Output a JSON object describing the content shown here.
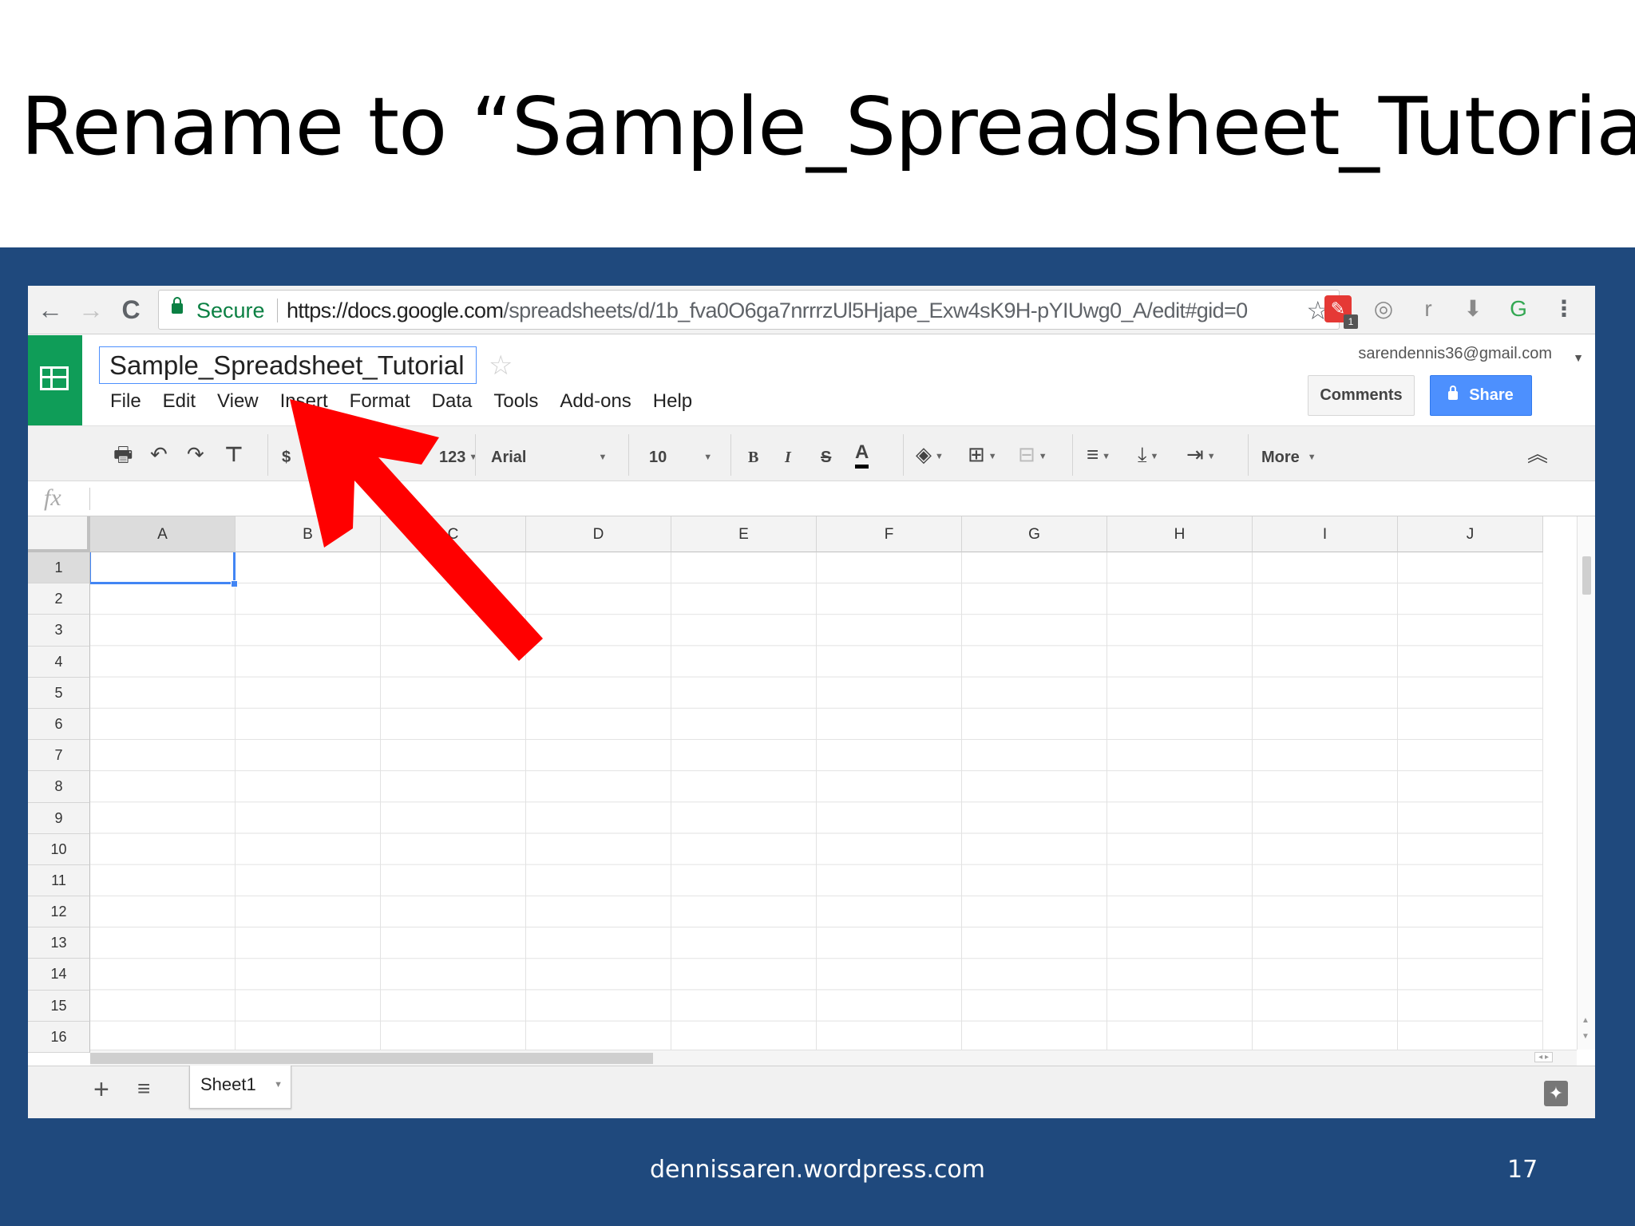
{
  "slide": {
    "title": "Rename to “Sample_Spreadsheet_Tutorial”",
    "footer_site": "dennissaren.wordpress.com",
    "page_number": "17"
  },
  "browser": {
    "back_icon": "←",
    "forward_icon": "→",
    "reload_icon": "C",
    "secure_label": "Secure",
    "url_host": "https://docs.google.com",
    "url_path": "/spreadsheets/d/1b_fva0O6ga7nrrrzUl5Hjape_Exw4sK9H-pYIUwg0_A/edit#gid=0",
    "bookmark_icon": "☆",
    "extensions": [
      "ext-red-icon",
      "ext-gray-icon",
      "ext-r-icon",
      "ext-download-icon",
      "ext-grammarly-icon",
      "menu-dots-icon"
    ],
    "ext_badge": "1",
    "ext_r_label": "r",
    "menu_icon": "⋮"
  },
  "sheets": {
    "doc_title": "Sample_Spreadsheet_Tutorial",
    "title_star": "☆",
    "menu": [
      "File",
      "Edit",
      "View",
      "Insert",
      "Format",
      "Data",
      "Tools",
      "Add-ons",
      "Help"
    ],
    "account": "sarendennis36@gmail.com",
    "comments_label": "Comments",
    "share_label": "Share"
  },
  "toolbar": {
    "currency": "$",
    "more_formats": "123",
    "font": "Arial",
    "font_size": "10",
    "bold": "B",
    "italic": "I",
    "strike": "S",
    "text_color": "A",
    "more_label": "More",
    "collapse_icon": "︽"
  },
  "formula": {
    "fx_label": "fx"
  },
  "grid": {
    "columns": [
      "A",
      "B",
      "C",
      "D",
      "E",
      "F",
      "G",
      "H",
      "I",
      "J"
    ],
    "rows": [
      "1",
      "2",
      "3",
      "4",
      "5",
      "6",
      "7",
      "8",
      "9",
      "10",
      "11",
      "12",
      "13",
      "14",
      "15",
      "16"
    ],
    "active_cell": "A1"
  },
  "tabs": {
    "add_icon": "+",
    "list_icon": "≡",
    "sheet_name": "Sheet1",
    "explore_icon": "✦"
  },
  "colors": {
    "panel_blue": "#1f497d",
    "sheets_green": "#0f9d58",
    "share_blue": "#4d90fe",
    "arrow_red": "#ff0000"
  }
}
